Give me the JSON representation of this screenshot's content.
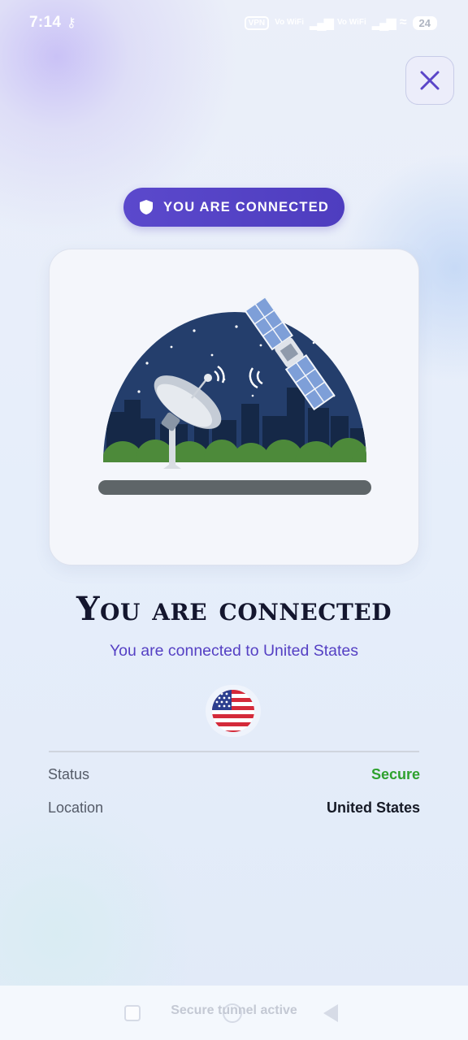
{
  "status_bar": {
    "time": "7:14",
    "vpn_label": "VPN",
    "volte_1": "Vo WiFi",
    "volte_2": "Vo WiFi",
    "battery": "24"
  },
  "badge": {
    "label": "YOU ARE CONNECTED"
  },
  "main": {
    "title": "You are connected",
    "subtitle": "You are connected to United States"
  },
  "details": {
    "status_label": "Status",
    "status_value": "Secure",
    "location_label": "Location",
    "location_value": "United States"
  },
  "footer": {
    "text": "Secure tunnel active"
  },
  "colors": {
    "accent": "#5540c4",
    "secure": "#2ea12e",
    "heading": "#14162e"
  },
  "icons": [
    "key-icon",
    "signal-icon",
    "wifi-icon",
    "battery-icon",
    "close-icon",
    "shield-icon",
    "us-flag-icon",
    "satellite-dish-icon",
    "satellite-icon"
  ]
}
